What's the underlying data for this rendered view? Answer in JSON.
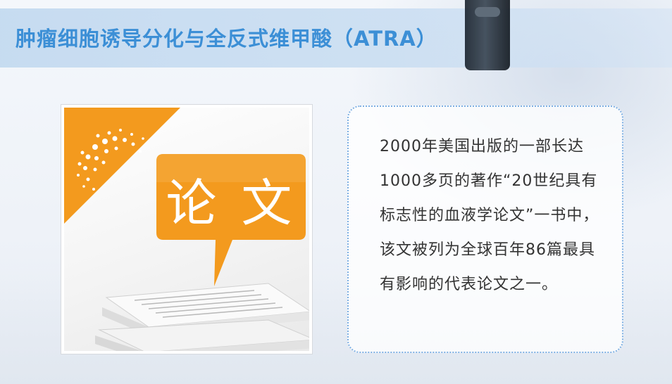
{
  "slide": {
    "title": "肿瘤细胞诱导分化与全反式维甲酸（ATRA）",
    "title_color": "#3c8fd6",
    "image_label": "论 文",
    "image_accent_color": "#f39a1e",
    "description": "2000年美国出版的一部长达1000多页的著作“20世纪具有标志性的血液学论文”一书中，该文被列为全球百年86篇最具有影响的代表论文之一。"
  }
}
